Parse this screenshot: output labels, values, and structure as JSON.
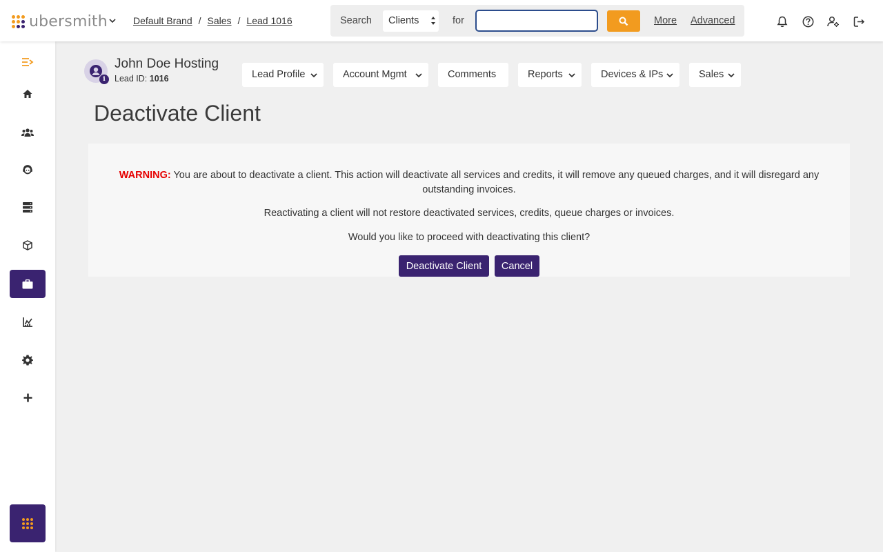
{
  "header": {
    "logo_text": "ubersmith",
    "breadcrumb": [
      "Default Brand",
      "Sales",
      "Lead 1016"
    ],
    "search": {
      "label": "Search",
      "scope_selected": "Clients",
      "for_label": "for",
      "input_value": "",
      "more_label": "More",
      "advanced_label": "Advanced"
    },
    "icons": [
      "bell-icon",
      "help-icon",
      "user-settings-icon",
      "logout-icon"
    ]
  },
  "sidebar": {
    "items": [
      {
        "name": "menu-collapse",
        "icon": "menu-collapse-icon"
      },
      {
        "name": "home",
        "icon": "home-icon"
      },
      {
        "name": "clients",
        "icon": "users-icon"
      },
      {
        "name": "support",
        "icon": "support-icon"
      },
      {
        "name": "devices",
        "icon": "server-icon"
      },
      {
        "name": "products",
        "icon": "package-icon"
      },
      {
        "name": "sales",
        "icon": "briefcase-icon",
        "active": true
      },
      {
        "name": "reports",
        "icon": "chart-icon"
      },
      {
        "name": "settings",
        "icon": "gear-icon"
      },
      {
        "name": "add",
        "icon": "plus-icon"
      }
    ],
    "apps_icon": "apps-icon"
  },
  "lead": {
    "name": "John Doe Hosting",
    "id_label": "Lead ID:",
    "id_value": "1016"
  },
  "tabs": [
    {
      "label": "Lead Profile",
      "dropdown": true
    },
    {
      "label": "Account Mgmt",
      "dropdown": true
    },
    {
      "label": "Comments",
      "dropdown": false
    },
    {
      "label": "Reports",
      "dropdown": true
    },
    {
      "label": "Devices & IPs",
      "dropdown": true
    },
    {
      "label": "Sales",
      "dropdown": true
    }
  ],
  "page": {
    "title": "Deactivate Client",
    "warning_label": "WARNING:",
    "warning_text": "You are about to deactivate a client. This action will deactivate all services and credits, it will remove any queued charges, and it will disregard any outstanding invoices.",
    "info_text": "Reactivating a client will not restore deactivated services, credits, queue charges or invoices.",
    "question_text": "Would you like to proceed with deactivating this client?",
    "deactivate_button": "Deactivate Client",
    "cancel_button": "Cancel"
  },
  "colors": {
    "brand_purple": "#3a2370",
    "brand_orange": "#f29b1f",
    "warning_red": "#e60000"
  }
}
